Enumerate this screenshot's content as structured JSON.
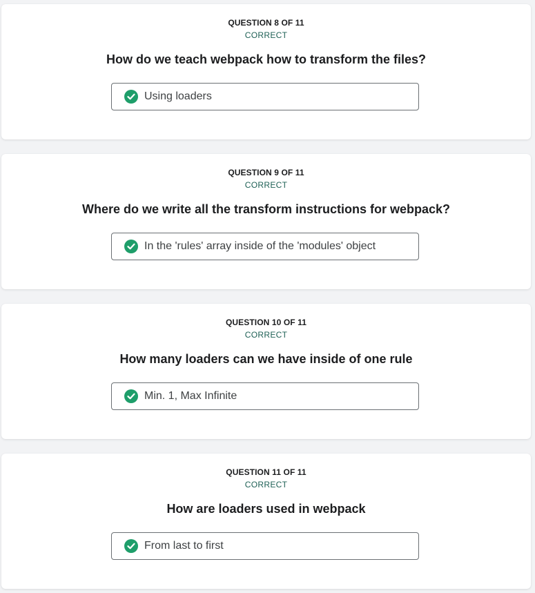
{
  "colors": {
    "background": "#f2f3f5",
    "card": "#ffffff",
    "correct_text": "#1e6055",
    "check_fill": "#1e9e6a",
    "answer_border": "#6a6f73"
  },
  "questions": [
    {
      "number_label": "QUESTION 8 OF 11",
      "status": "CORRECT",
      "question": "How do we teach webpack how to transform the files?",
      "answer": "Using loaders",
      "icon": "check-circle-icon"
    },
    {
      "number_label": "QUESTION 9 OF 11",
      "status": "CORRECT",
      "question": "Where do we write all the transform instructions for webpack?",
      "answer": "In the 'rules' array inside of the 'modules' object",
      "icon": "check-circle-icon"
    },
    {
      "number_label": "QUESTION 10 OF 11",
      "status": "CORRECT",
      "question": "How many loaders can we have inside of one rule",
      "answer": "Min. 1, Max Infinite",
      "icon": "check-circle-icon"
    },
    {
      "number_label": "QUESTION 11 OF 11",
      "status": "CORRECT",
      "question": "How are loaders used in webpack",
      "answer": "From last to first",
      "icon": "check-circle-icon"
    }
  ]
}
